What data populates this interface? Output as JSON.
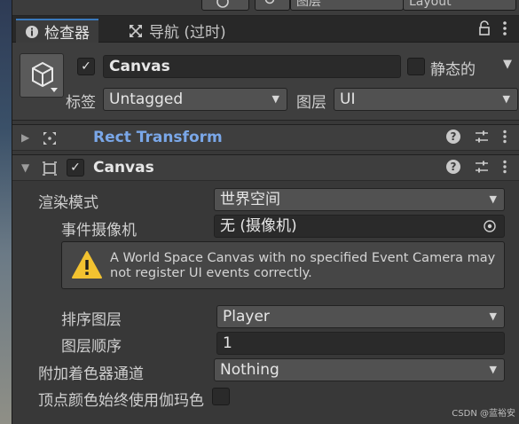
{
  "top_toolbar": {
    "layers_label": "图层",
    "layout_label": "Layout"
  },
  "tabs": [
    {
      "label": "检查器",
      "icon": "info-icon",
      "active": true
    },
    {
      "label": "导航 (过时)",
      "icon": "navigation-icon",
      "active": false
    }
  ],
  "object": {
    "name": "Canvas",
    "active": true,
    "static_label": "静态的",
    "tag_label": "标签",
    "tag_value": "Untagged",
    "layer_label": "图层",
    "layer_value": "UI"
  },
  "components": {
    "rect_transform": {
      "title": "Rect Transform",
      "title_color": "#7aa7e8"
    },
    "canvas": {
      "title": "Canvas",
      "enabled": true,
      "render_mode_label": "渲染模式",
      "render_mode_value": "世界空间",
      "event_camera_label": "事件摄像机",
      "event_camera_value": "无 (摄像机)",
      "warning_text": "A World Space Canvas with no specified Event Camera may not register UI events correctly.",
      "sorting_layer_label": "排序图层",
      "sorting_layer_value": "Player",
      "order_in_layer_label": "图层顺序",
      "order_in_layer_value": "1",
      "additional_shader_channels_label": "附加着色器通道",
      "additional_shader_channels_value": "Nothing",
      "vertex_color_gamma_label": "顶点颜色始终使用伽玛色"
    }
  },
  "watermark": "CSDN @蓝裕安",
  "colors": {
    "accent_tab": "#3a79bb",
    "warning_yellow": "#f2c230"
  }
}
